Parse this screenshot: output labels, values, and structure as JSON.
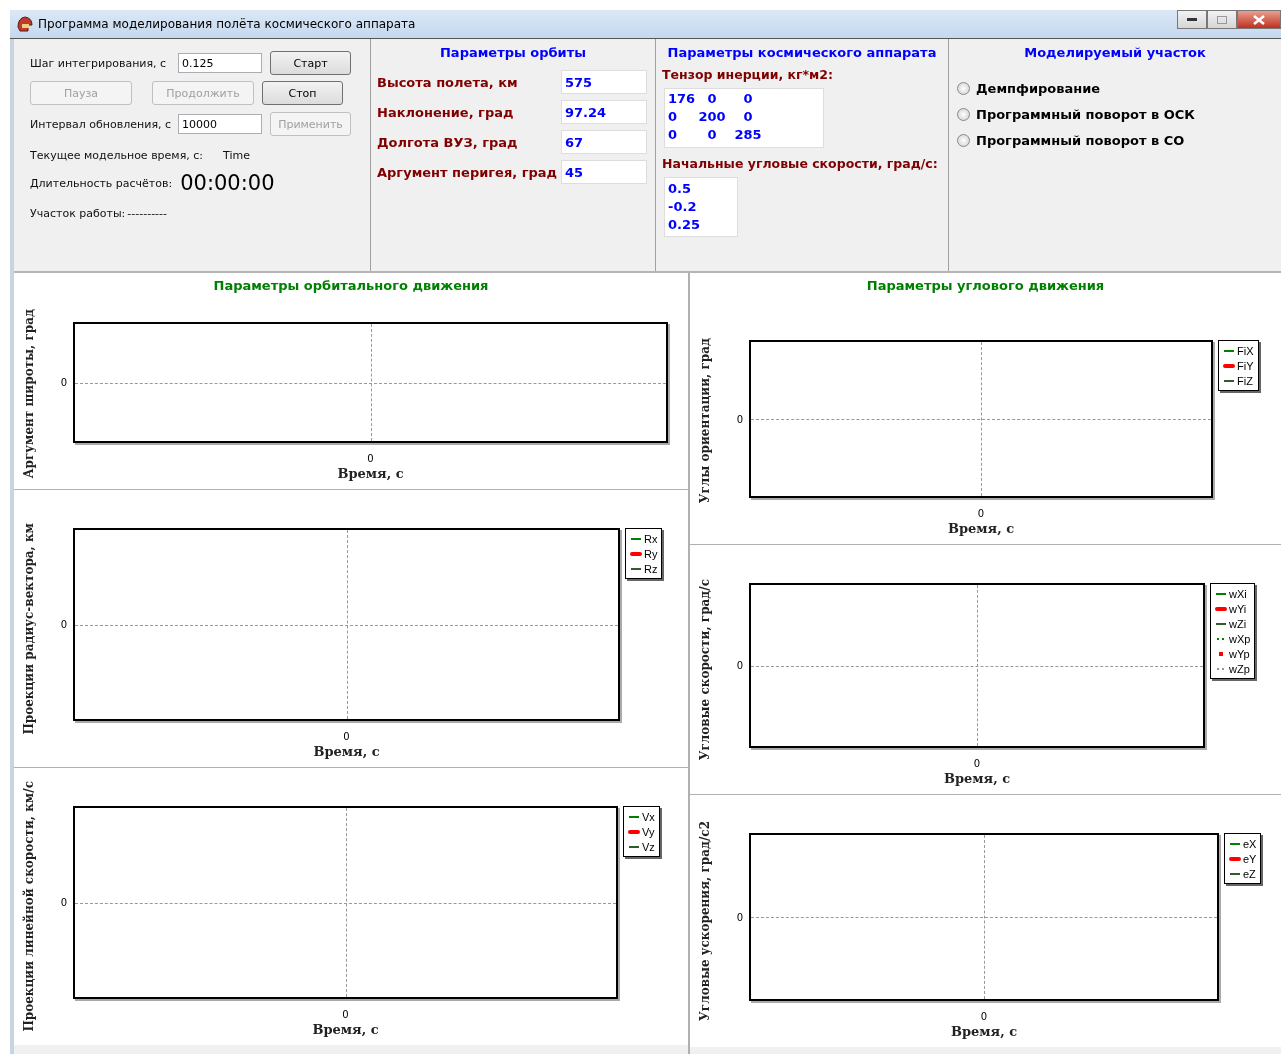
{
  "window": {
    "title": "Программа моделирования полёта космического аппарата"
  },
  "controls": {
    "step_label": "Шаг интегрирования, с",
    "step_value": "0.125",
    "interval_label": "Интервал обновления, с",
    "interval_value": "10000",
    "buttons": [
      {
        "label": "Старт",
        "disabled": false
      },
      {
        "label": "Пауза",
        "disabled": true
      },
      {
        "label": "Продолжить",
        "disabled": true
      },
      {
        "label": "Стоп",
        "disabled": false
      },
      {
        "label": "Применить",
        "disabled": true
      }
    ],
    "model_time_label": "Текущее модельное время, с:",
    "model_time_value": "Time",
    "duration_label": "Длительность расчётов:",
    "duration_value": "00:00:00",
    "segment_label": "Участок работы:",
    "segment_value": "----------"
  },
  "orbit": {
    "title": "Параметры орбиты",
    "params": [
      {
        "label": "Высота полета, км",
        "value": "575"
      },
      {
        "label": "Наклонение, град",
        "value": "97.24"
      },
      {
        "label": "Долгота ВУЗ, град",
        "value": "67"
      },
      {
        "label": "Аргумент перигея, град",
        "value": "45"
      }
    ]
  },
  "spacecraft": {
    "title": "Параметры космического аппарата",
    "tensor_label": "Тензор инерции, кг*м2:",
    "tensor": [
      [
        "176",
        "0",
        "0"
      ],
      [
        "0",
        "200",
        "0"
      ],
      [
        "0",
        "0",
        "285"
      ]
    ],
    "rates_label": "Начальные угловые скорости, град/с:",
    "rates": [
      "0.5",
      "-0.2",
      "0.25"
    ]
  },
  "segment": {
    "title": "Моделируемый участок",
    "options": [
      {
        "label": "Демпфирование",
        "selected": false
      },
      {
        "label": "Программный поворот в ОСК",
        "selected": false
      },
      {
        "label": "Программный поворот в СО",
        "selected": false
      }
    ]
  },
  "left": {
    "title": "Параметры орбитального движения",
    "charts": [
      {
        "ylabel": "Аргумент широты, град",
        "ytick": "0",
        "xtick": "0",
        "xlabel": "Время, с"
      },
      {
        "ylabel": "Проекции радиус-вектора, км",
        "ytick": "0",
        "xtick": "0",
        "xlabel": "Время, с",
        "legend": [
          {
            "label": "Rx",
            "color": "#008000",
            "kind": "line"
          },
          {
            "label": "Ry",
            "color": "#ff0000",
            "kind": "thick"
          },
          {
            "label": "Rz",
            "color": "#2e5e2e",
            "kind": "line"
          }
        ]
      },
      {
        "ylabel": "Проекции линейной скорости, км/с",
        "ytick": "0",
        "xtick": "0",
        "xlabel": "Время, с",
        "legend": [
          {
            "label": "Vx",
            "color": "#008000",
            "kind": "line"
          },
          {
            "label": "Vy",
            "color": "#ff0000",
            "kind": "thick"
          },
          {
            "label": "Vz",
            "color": "#2e5e2e",
            "kind": "line"
          }
        ]
      }
    ]
  },
  "right": {
    "title": "Параметры углового движения",
    "charts": [
      {
        "ylabel": "Углы ориентации, град",
        "ytick": "0",
        "xtick": "0",
        "xlabel": "Время, с",
        "legend": [
          {
            "label": "FiX",
            "color": "#008000",
            "kind": "line"
          },
          {
            "label": "FiY",
            "color": "#ff0000",
            "kind": "thick"
          },
          {
            "label": "FiZ",
            "color": "#2e5e2e",
            "kind": "line"
          }
        ]
      },
      {
        "ylabel": "Угловые скорости, град/с",
        "ytick": "0",
        "xtick": "0",
        "xlabel": "Время, с",
        "legend": [
          {
            "label": "wXi",
            "color": "#008000",
            "kind": "line"
          },
          {
            "label": "wYi",
            "color": "#ff0000",
            "kind": "thick"
          },
          {
            "label": "wZi",
            "color": "#2e5e2e",
            "kind": "line"
          },
          {
            "label": "wXp",
            "color": "#008000",
            "kind": "dots"
          },
          {
            "label": "wYp",
            "color": "#ff0000",
            "kind": "square"
          },
          {
            "label": "wZp",
            "color": "#8aa08a",
            "kind": "dots"
          }
        ]
      },
      {
        "ylabel": "Угловые ускорения, град/с2",
        "ytick": "0",
        "xtick": "0",
        "xlabel": "Время, с",
        "legend": [
          {
            "label": "eX",
            "color": "#008000",
            "kind": "line"
          },
          {
            "label": "eY",
            "color": "#ff0000",
            "kind": "thick"
          },
          {
            "label": "eZ",
            "color": "#2e5e2e",
            "kind": "line"
          }
        ]
      }
    ]
  }
}
